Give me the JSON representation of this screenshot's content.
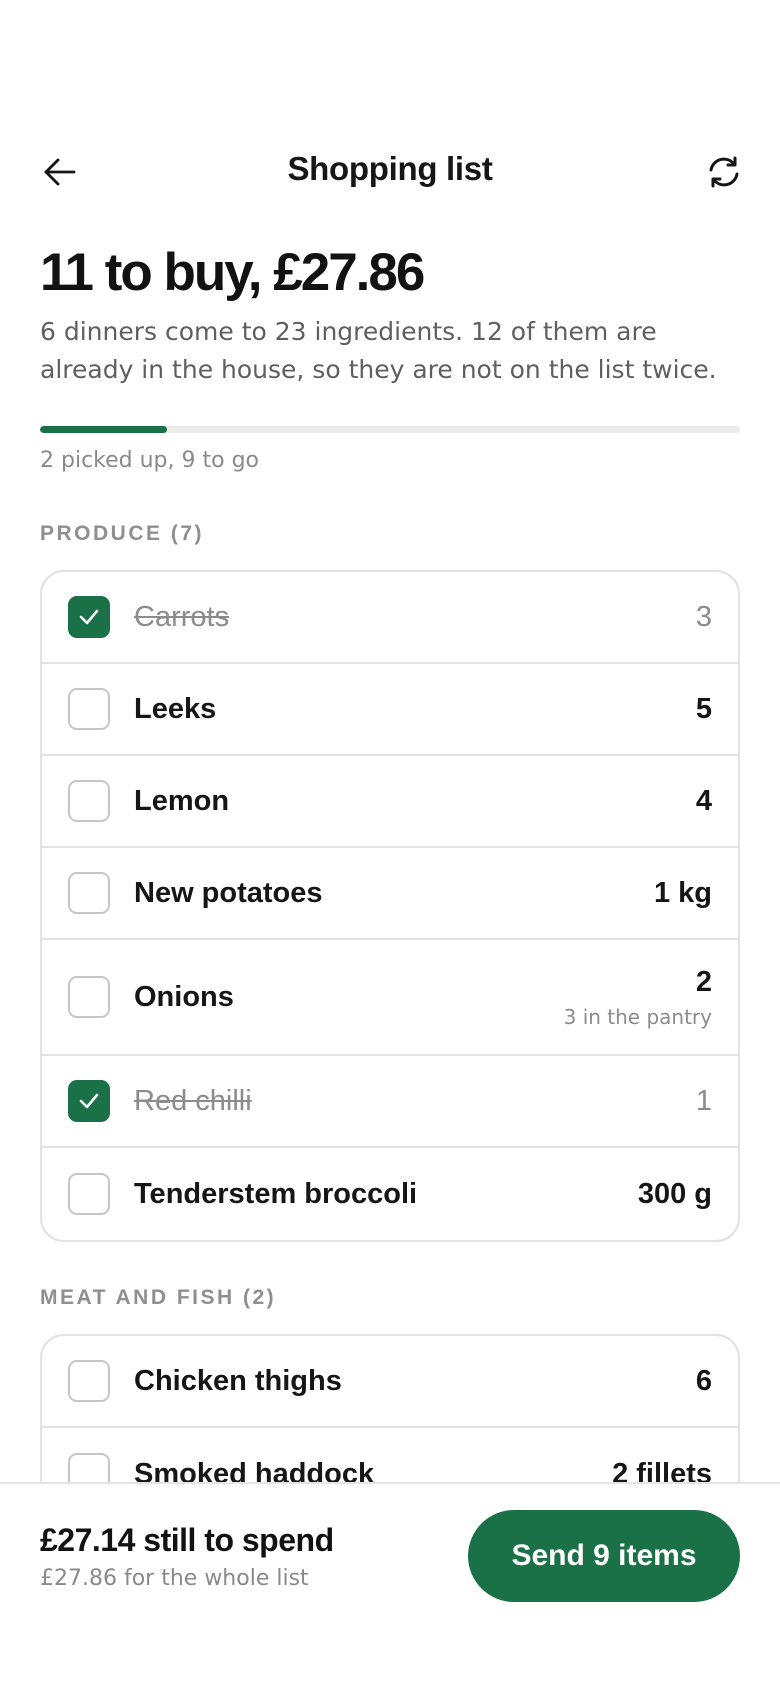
{
  "header": {
    "title": "Shopping list",
    "back_icon": "arrow-left-icon",
    "refresh_icon": "refresh-icon"
  },
  "summary": {
    "heading": "11 to buy, £27.86",
    "description": "6 dinners come to 23 ingredients. 12 of them are already in the house, so they are not on the list twice.",
    "progress_label": "2 picked up, 9 to go",
    "progress_fraction": 0.182
  },
  "sections": [
    {
      "label": "PRODUCE (7)",
      "items": [
        {
          "name": "Carrots",
          "qty": "3",
          "checked": true,
          "note": ""
        },
        {
          "name": "Leeks",
          "qty": "5",
          "checked": false,
          "note": ""
        },
        {
          "name": "Lemon",
          "qty": "4",
          "checked": false,
          "note": ""
        },
        {
          "name": "New potatoes",
          "qty": "1 kg",
          "checked": false,
          "note": ""
        },
        {
          "name": "Onions",
          "qty": "2",
          "checked": false,
          "note": "3 in the pantry"
        },
        {
          "name": "Red chilli",
          "qty": "1",
          "checked": true,
          "note": ""
        },
        {
          "name": "Tenderstem broccoli",
          "qty": "300 g",
          "checked": false,
          "note": ""
        }
      ]
    },
    {
      "label": "MEAT AND FISH (2)",
      "items": [
        {
          "name": "Chicken thighs",
          "qty": "6",
          "checked": false,
          "note": ""
        },
        {
          "name": "Smoked haddock",
          "qty": "2 fillets",
          "checked": false,
          "note": ""
        }
      ]
    }
  ],
  "footer": {
    "remaining": "£27.14 still to spend",
    "whole_list": "£27.86 for the whole list",
    "send_label": "Send 9 items"
  },
  "colors": {
    "accent": "#1a7047",
    "muted_text": "#8a8a8a",
    "border": "#e2e2e2"
  }
}
